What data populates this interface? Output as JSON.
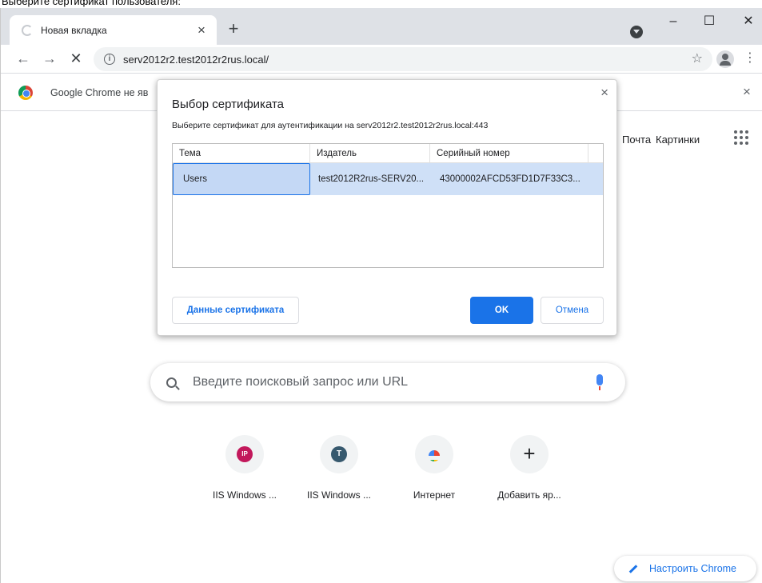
{
  "instruction": "Выберите сертификат пользователя:",
  "tab": {
    "title": "Новая вкладка",
    "close": "×",
    "new_tab": "+"
  },
  "window_controls": {
    "minimize": "–",
    "maximize": "☐",
    "close": "✕"
  },
  "toolbar": {
    "back": "←",
    "forward": "→",
    "stop": "✕",
    "info": "i",
    "url": "serv2012r2.test2012r2rus.local/",
    "star": "☆",
    "menu": "⋮"
  },
  "infobar": {
    "text": "Google Chrome не яв",
    "close": "×"
  },
  "ntp": {
    "links": [
      "Почта",
      "Картинки"
    ],
    "search_placeholder": "Введите поисковый запрос или URL",
    "shortcuts": [
      {
        "label": "IIS Windows ...",
        "initials": "IP",
        "color": "#c2185b"
      },
      {
        "label": "IIS Windows ...",
        "initials": "T",
        "color": "#37596e"
      },
      {
        "label": "Интернет",
        "initials": "",
        "color": ""
      },
      {
        "label": "Добавить яр...",
        "initials": "+",
        "color": ""
      }
    ],
    "customize": "Настроить Chrome"
  },
  "dialog": {
    "title": "Выбор сертификата",
    "subtitle": "Выберите сертификат для аутентификации на serv2012r2.test2012r2rus.local:443",
    "close": "×",
    "columns": [
      "Тема",
      "Издатель",
      "Серийный номер"
    ],
    "rows": [
      {
        "subject": "Users",
        "issuer": "test2012R2rus-SERV20...",
        "serial": "43000002AFCD53FD1D7F33C3..."
      }
    ],
    "details_button": "Данные сертификата",
    "ok_button": "OK",
    "cancel_button": "Отмена"
  },
  "colors": {
    "accent": "#1a73e8",
    "selection": "#cfe0f7",
    "tabstrip": "#dee1e6"
  }
}
